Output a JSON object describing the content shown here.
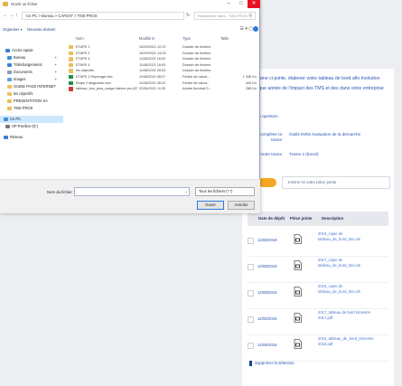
{
  "dialog": {
    "title": "Ouvrir un fichier",
    "window_controls": [
      "–",
      "□",
      "✕"
    ],
    "nav_buttons": [
      "←",
      "→",
      "↑"
    ],
    "address": "Ce PC > Bureau > CARSAT > TMS PROS",
    "refresh": "↻",
    "search_placeholder": "Rechercher dans : TMS PROS",
    "toolbar": {
      "organize": "Organiser ▾",
      "new_folder": "Nouveau dossier",
      "view_icons": "☰ ▾  ▢"
    },
    "columns": {
      "name": "Nom",
      "modified": "Modifié le",
      "type": "Type",
      "size": "Taille"
    },
    "nav_items": [
      {
        "label": "Accès rapide",
        "icon_color": "#3b7fd4"
      },
      {
        "label": "Bureau",
        "icon_color": "#3b8ed8"
      },
      {
        "label": "Téléchargements",
        "icon_color": "#3b7fd4"
      },
      {
        "label": "Documents",
        "icon_color": "#8a9bb5"
      },
      {
        "label": "Images",
        "icon_color": "#5fa0d8"
      },
      {
        "label": "GUIDE PAGE INTERNET",
        "icon_color": "#e8c15a"
      },
      {
        "label": "les objectifs",
        "icon_color": "#e8c15a"
      },
      {
        "label": "PRESENTATION SA",
        "icon_color": "#e8c15a"
      },
      {
        "label": "TMS PROS",
        "icon_color": "#e8c15a"
      },
      {
        "label": "Ce PC",
        "icon_color": "#3b8ed8"
      },
      {
        "label": "HP Pavilion (D:)",
        "icon_color": "#777777"
      },
      {
        "label": "Réseau",
        "icon_color": "#3b7fd4"
      }
    ],
    "files": [
      {
        "name": "ETAPE 1",
        "modified": "10/09/2021 12:22",
        "type": "Dossier de fichiers",
        "size": "",
        "icon_color": "#e8c15a"
      },
      {
        "name": "ETAPE 2",
        "modified": "10/09/2021 14:20",
        "type": "Dossier de fichiers",
        "size": "",
        "icon_color": "#e8c15a"
      },
      {
        "name": "ETAPE 3",
        "modified": "11/08/2021 16:09",
        "type": "Dossier de fichiers",
        "size": "",
        "icon_color": "#e8c15a"
      },
      {
        "name": "ETAPE 4",
        "modified": "11/08/2021 16:00",
        "type": "Dossier de fichiers",
        "size": "",
        "icon_color": "#e8c15a"
      },
      {
        "name": "les objectifs",
        "modified": "11/08/2021 09:03",
        "type": "Dossier de fichiers",
        "size": "",
        "icon_color": "#e8c15a"
      },
      {
        "name": "ETAPE 2 Repérage.xlsx",
        "modified": "11/08/2021 08:27",
        "type": "Feuille de calcul...",
        "size": "1 348 Ko",
        "icon_color": "#1f8f4a"
      },
      {
        "name": "Etape 2 diagnostic.xlsx",
        "modified": "11/08/2021 08:22",
        "type": "Feuille de calcul...",
        "size": "400 Ko",
        "icon_color": "#1f8f4a"
      },
      {
        "name": "tableau_tms_pros_usage-interne.pro (83...",
        "modified": "22/06/2021 11:30",
        "type": "Adobe Acrobat D...",
        "size": "288 Ko",
        "icon_color": "#d13b2f"
      }
    ],
    "filename_label": "Nom du fichier :",
    "filename_value": "",
    "filetype": "Tous les fichiers (*.*)",
    "open_label": "Ouvrir",
    "cancel_label": "Annuler"
  },
  "page": {
    "intro": "la trame ci-jointe, élaborer votre tableau de bord afin évolution chaque année de l'impact des TMS et des dans votre entreprise",
    "link_next": "Cette question",
    "form": {
      "completer_label": "Pour compléter la trame",
      "completer_value": "Outils INRS évaluation de la démarche",
      "trame_label": "Votre trame",
      "trame_value": "Trame 2 (Excel)"
    },
    "upload_placeholder": "Insérer ici votre pièce jointe",
    "files_section": "Joint",
    "table_headers": [
      "Date de dépôt",
      "Pièce jointe",
      "Description"
    ],
    "rows": [
      {
        "date": "12/08/2019",
        "desc": "2018_copie de tableau_de_bord_tms.xls"
      },
      {
        "date": "12/08/2019",
        "desc": "2017_copie de tableau_de_bord_tms.xls"
      },
      {
        "date": "12/08/2019",
        "desc": "2016_copie de tableau_de_bord_tms.xls"
      },
      {
        "date": "12/08/2019",
        "desc": "2017_tableau de bord trimestre 2017.pdf"
      },
      {
        "date": "12/08/2019",
        "desc": "2018_tableau_de_bord_trimestre 2018.pdf"
      }
    ],
    "delete_selection": "Supprimer la sélection"
  }
}
